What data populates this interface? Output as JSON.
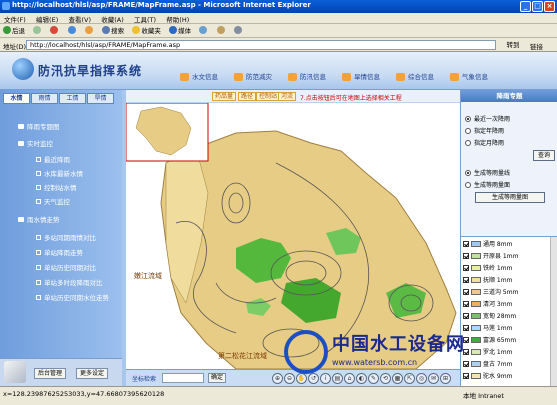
{
  "window": {
    "title": "http://localhost/hlsl/asp/FRAME/MapFrame.asp - Microsoft Internet Explorer"
  },
  "menubar": {
    "items": [
      "文件(F)",
      "编辑(E)",
      "查看(V)",
      "收藏(A)",
      "工具(T)",
      "帮助(H)"
    ]
  },
  "toolbar": {
    "back": "后退",
    "search": "搜索",
    "favorites": "收藏夹",
    "media": "媒体"
  },
  "addressbar": {
    "label": "地址(D)",
    "url": "http://localhost/hlsl/asp/FRAME/MapFrame.asp",
    "go": "转到",
    "links": "链接"
  },
  "app": {
    "title": "防汛抗旱指挥系统"
  },
  "nav": {
    "tabs": [
      "水文信息",
      "防范减灾",
      "防汛信息",
      "旱情信息",
      "综合信息",
      "气象信息"
    ]
  },
  "left": {
    "tabs": [
      "水情",
      "雨情",
      "工情",
      "旱情"
    ],
    "tree": [
      {
        "label": "降雨专题图",
        "level": 0
      },
      {
        "label": "实时监控",
        "level": 0
      },
      {
        "label": "最近降雨",
        "level": 1
      },
      {
        "label": "水库最新水情",
        "level": 1
      },
      {
        "label": "控制站水情",
        "level": 1
      },
      {
        "label": "天气监控",
        "level": 1
      },
      {
        "label": "雨水情走势",
        "level": 0
      },
      {
        "label": "多站同期雨情对比",
        "level": 1
      },
      {
        "label": "单站降雨走势",
        "level": 1
      },
      {
        "label": "单站历史同期对比",
        "level": 1
      },
      {
        "label": "单站多时段降雨对比",
        "level": 1
      },
      {
        "label": "单站历史同期水位走势",
        "level": 1
      }
    ],
    "buttons": {
      "admin": "后台管理",
      "settings": "更多设定"
    }
  },
  "map": {
    "toolbar": [
      "药品量",
      "路径",
      "控制站",
      "河流"
    ],
    "hint": "7.点击按钮后可在地图上选择相关工程",
    "labels": {
      "region1": "嫩江流域",
      "region2": "第二松花江流域"
    },
    "coord_label": "坐标检索",
    "coord_go": "确定",
    "tools": [
      "⊕",
      "⊖",
      "✋",
      "↺",
      "i",
      "▤",
      "⌂",
      "◐",
      "✎",
      "⟲",
      "▦",
      "⇱",
      "◎",
      "✉",
      "⊞",
      "?"
    ]
  },
  "right": {
    "header": "降雨专题",
    "options1": [
      {
        "label": "最近一次降雨",
        "checked": true
      },
      {
        "label": "指定年降雨",
        "checked": false
      },
      {
        "label": "指定月降雨",
        "checked": false
      }
    ],
    "query": "查询",
    "options2": [
      {
        "label": "生成等雨量线",
        "checked": true
      },
      {
        "label": "生成等雨量面",
        "checked": false
      }
    ],
    "generate": "生成等雨量图",
    "legend": [
      {
        "label": "通用 8mm",
        "color": "#a0c8f0"
      },
      {
        "label": "开原县 1mm",
        "color": "#c0e0a0"
      },
      {
        "label": "铁岭 1mm",
        "color": "#e6f0a0"
      },
      {
        "label": "抚顺 1mm",
        "color": "#f0e0a0"
      },
      {
        "label": "三道沟 5mm",
        "color": "#f0c890"
      },
      {
        "label": "清河 3mm",
        "color": "#e8b060"
      },
      {
        "label": "宽甸 28mm",
        "color": "#7cc070"
      },
      {
        "label": "马莲 1mm",
        "color": "#a8d8ff"
      },
      {
        "label": "富源 65mm",
        "color": "#3fae3f"
      },
      {
        "label": "罗北 1mm",
        "color": "#d8e8b0"
      },
      {
        "label": "盘古 7mm",
        "color": "#b0d0f0"
      },
      {
        "label": "驼水 9mm",
        "color": "#f4e4b0"
      }
    ]
  },
  "status": {
    "text": "x=128.23987625253033,y=47.66807395620128",
    "zone": "本地 Intranet"
  },
  "watermark": {
    "title": "中国水工设备网",
    "url": "www.watersb.com.cn"
  }
}
